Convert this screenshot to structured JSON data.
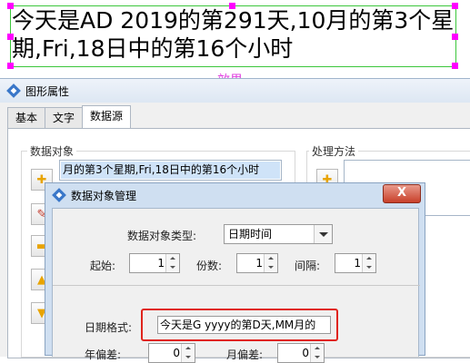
{
  "preview": {
    "text": "今天是AD 2019的第291天,10月的第3个星期,Fri,18日中的第16个小时",
    "effect_label": "效果"
  },
  "props_window": {
    "title": "图形属性",
    "tabs": [
      {
        "label": "基本"
      },
      {
        "label": "文字"
      },
      {
        "label": "数据源",
        "active": true
      }
    ],
    "data_objects_label": "数据对象",
    "data_object_item": "月的第3个星期,Fri,18日中的第16个小时",
    "process_method_label": "处理方法"
  },
  "dialog": {
    "title": "数据对象管理",
    "close_label": "X",
    "type_label": "数据对象类型:",
    "type_value": "日期时间",
    "start_label": "起始:",
    "start_value": "1",
    "count_label": "份数:",
    "count_value": "1",
    "interval_label": "间隔:",
    "interval_value": "1",
    "date_format_label": "日期格式:",
    "date_format_value": "今天是G yyyy的第D天,MM月的",
    "year_offset_label": "年偏差:",
    "year_offset_value": "0",
    "month_offset_label": "月偏差:",
    "month_offset_value": "0"
  },
  "colors": {
    "highlight": "#e0241c",
    "preview_border": "#3cc63c",
    "handle": "#ff00ff",
    "effect_label": "#e040e0"
  }
}
